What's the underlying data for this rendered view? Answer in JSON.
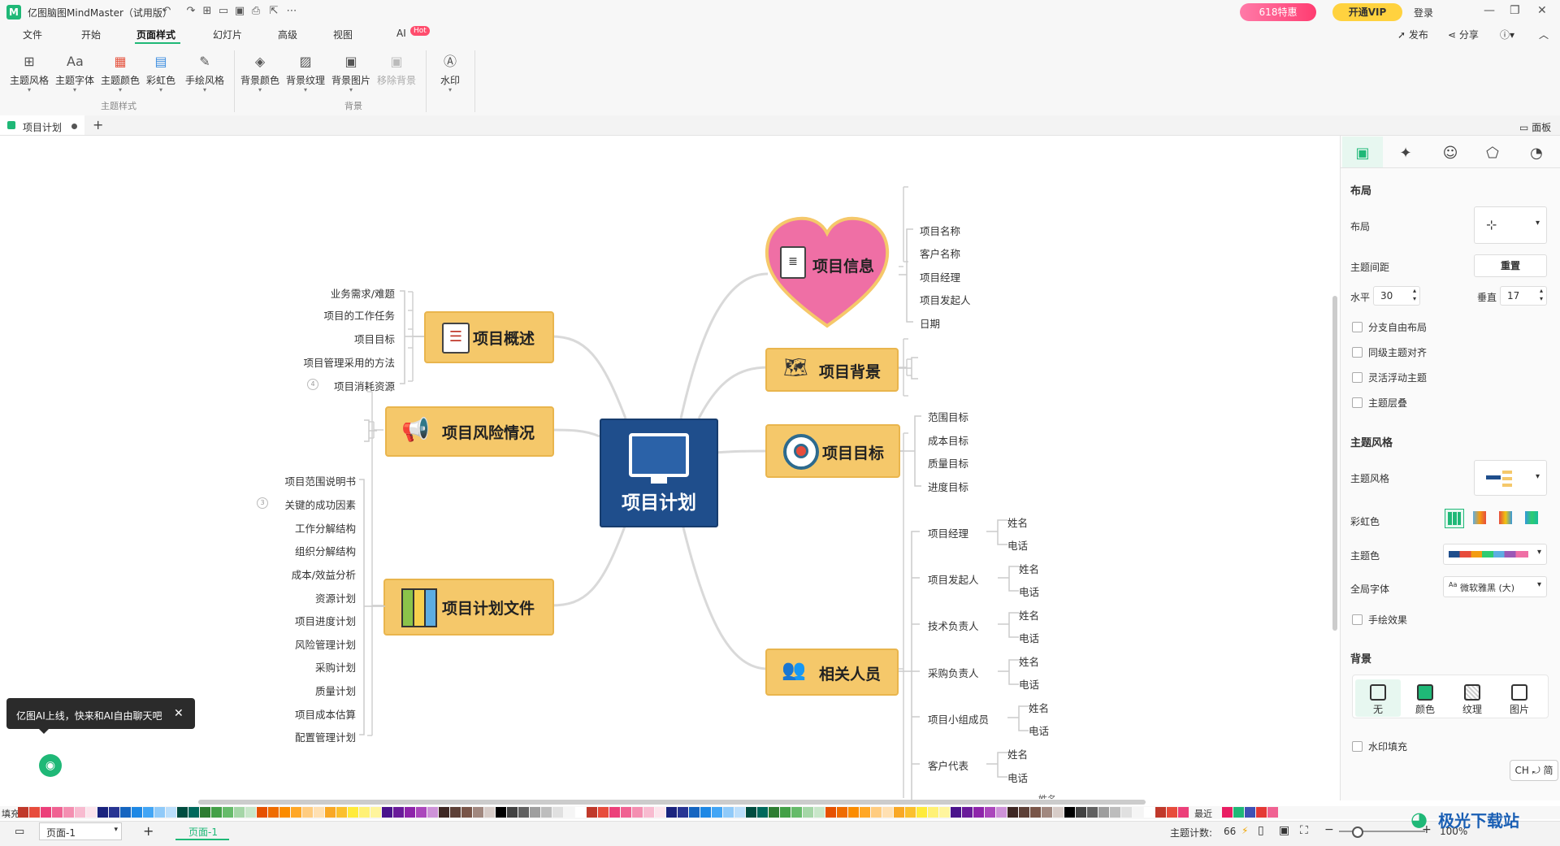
{
  "app": {
    "title": "亿图脑图MindMaster（试用版）",
    "promo": "618特惠",
    "vip": "开通VIP",
    "login": "登录",
    "publish": "发布",
    "share": "分享",
    "help": "?"
  },
  "menu": [
    "文件",
    "开始",
    "页面样式",
    "幻灯片",
    "高级",
    "视图",
    "AI"
  ],
  "menu_hot": "Hot",
  "ribbon": {
    "buttons": [
      "主题风格",
      "主题字体",
      "主题颜色",
      "彩虹色",
      "手绘风格",
      "背景颜色",
      "背景纹理",
      "背景图片",
      "移除背景",
      "水印"
    ],
    "group_theme": "主题样式",
    "group_bg": "背景"
  },
  "doc": {
    "tab": "项目计划",
    "panel": "面板"
  },
  "mindmap": {
    "center": "项目计划",
    "topics": {
      "overview": "项目概述",
      "risk": "项目风险情况",
      "planfile": "项目计划文件",
      "info": "项目信息",
      "background": "项目背景",
      "goal": "项目目标",
      "people": "相关人员"
    },
    "overview_items": [
      "业务需求/难题",
      "项目的工作任务",
      "项目目标",
      "项目管理采用的方法",
      "项目消耗资源"
    ],
    "planfile_items": [
      "项目范围说明书",
      "关键的成功因素",
      "工作分解结构",
      "组织分解结构",
      "成本/效益分析",
      "资源计划",
      "项目进度计划",
      "风险管理计划",
      "采购计划",
      "质量计划",
      "项目成本估算",
      "配置管理计划"
    ],
    "info_items": [
      "项目名称",
      "客户名称",
      "项目经理",
      "项目发起人",
      "日期"
    ],
    "goal_items": [
      "范围目标",
      "成本目标",
      "质量目标",
      "进度目标"
    ],
    "people_roles": [
      "项目经理",
      "项目发起人",
      "技术负责人",
      "采购负责人",
      "项目小组成员",
      "客户代表"
    ],
    "people_sub": [
      "姓名",
      "电话"
    ]
  },
  "panel": {
    "layout_title": "布局",
    "layout_label": "布局",
    "spacing_label": "主题间距",
    "reset": "重置",
    "h_label": "水平",
    "h_value": "30",
    "v_label": "垂直",
    "v_value": "17",
    "checks": [
      "分支自由布局",
      "同级主题对齐",
      "灵活浮动主题",
      "主题层叠"
    ],
    "style_title": "主题风格",
    "style_label": "主题风格",
    "rainbow_label": "彩虹色",
    "color_label": "主题色",
    "font_label": "全局字体",
    "font_value": "微软雅黑 (大)",
    "handdrawn": "手绘效果",
    "bg_title": "背景",
    "bg_opts": [
      "无",
      "颜色",
      "纹理",
      "图片"
    ],
    "watermark_fill": "水印填充",
    "ime": "CH ⤾ 简"
  },
  "bottom": {
    "fill": "填充",
    "recent": "最近",
    "page_select": "页面-1",
    "page_tab": "页面-1",
    "topic_count_label": "主题计数:",
    "topic_count": "66",
    "zoom": "100%"
  },
  "ai_toast": "亿图AI上线，快来和AI自由聊天吧",
  "watermark": "极光下载站",
  "colors": {
    "accent": "#1fb877",
    "topic_fill": "#f5c86a",
    "center_fill": "#1f4e8c",
    "heart": "#ef6fa5"
  }
}
